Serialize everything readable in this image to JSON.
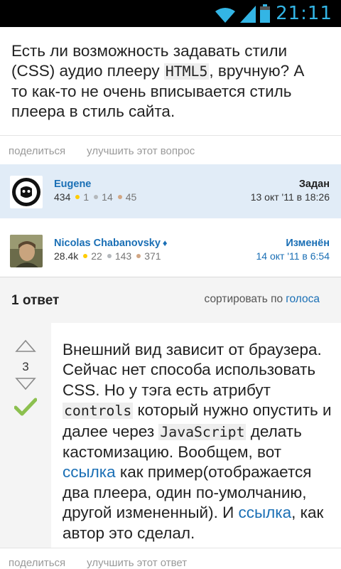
{
  "status_bar": {
    "time": "21:11",
    "icons": [
      "wifi-icon",
      "signal-icon",
      "battery-icon"
    ],
    "accent_color": "#33b5e5"
  },
  "question": {
    "part1": "Есть ли возможность задавать стили (CSS) аудио плееру ",
    "code1": "HTML5",
    "part2": ", вручную? А то как-то не очень вписывается стиль плеера в стиль сайта.",
    "actions": {
      "share": "поделиться",
      "improve": "улучшить этот вопрос"
    }
  },
  "asked_by": {
    "name": "Eugene",
    "reputation": "434",
    "gold": "1",
    "silver": "14",
    "bronze": "45",
    "label": "Задан",
    "date": "13 окт '11 в 18:26"
  },
  "edited_by": {
    "name": "Nicolas Chabanovsky",
    "moderator_badge": "♦",
    "reputation": "28.4k",
    "gold": "22",
    "silver": "143",
    "bronze": "371",
    "label": "Изменён",
    "date": "14 окт '11 в 6:54"
  },
  "answers_header": {
    "count_label": "1 ответ",
    "sort_prefix": "сортировать по",
    "sort_value": "голоса"
  },
  "answer": {
    "votes": "3",
    "accepted": true,
    "t1": "Внешний вид зависит от браузера. Сейчас нет способа использовать CSS. Но у тэга есть атрибут ",
    "code1": "controls",
    "t2": " который нужно опустить и далее через ",
    "code2": "JavaScript",
    "t3": " делать кастомизацию. Вообщем, вот ",
    "link1": "ссылка",
    "t4": " как пример(отображается два плеера, один по-умолчанию, другой измененный). И ",
    "link2": "ссылка",
    "t5": ", как автор это сделал.",
    "actions": {
      "share": "поделиться",
      "improve": "улучшить этот ответ"
    }
  },
  "colors": {
    "link": "#1a6fb5",
    "accepted_check": "#8cc04f",
    "asked_card_bg": "#e1ecf7",
    "badge_gold": "#ffcc01",
    "badge_silver": "#b4b8bc",
    "badge_bronze": "#d1a684"
  }
}
